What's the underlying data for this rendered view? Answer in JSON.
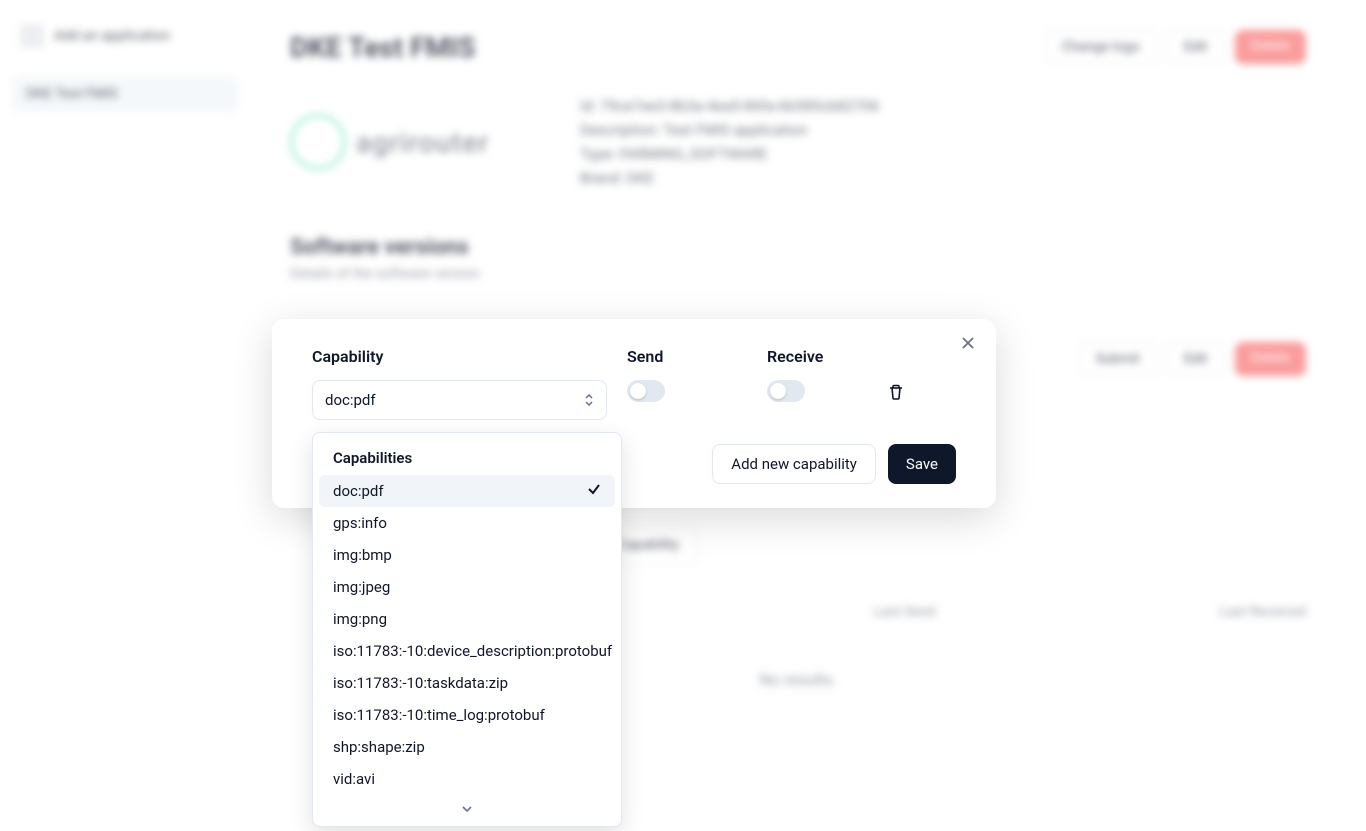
{
  "sidebar": {
    "nav_label": "Add an application",
    "active_item": "DKE Test FMIS"
  },
  "page": {
    "title": "DKE Test FMIS",
    "actions": {
      "change_logo": "Change logo",
      "edit": "Edit",
      "delete": "Delete"
    },
    "logo_text": "agrirouter",
    "meta": {
      "id_line": "Id: 79ce7ee3-8b3a-4ea5-86fa-6b585cb82706",
      "desc_line": "Description: Test FMIS application",
      "type_line": "Type: FARMING_SOFTWARE",
      "brand_line": "Brand: DKE"
    },
    "sv_title": "Software versions",
    "sv_sub": "Details of the software version",
    "version_actions": {
      "submit": "Submit",
      "edit": "Edit",
      "delete": "Delete"
    },
    "add_capability": "Add Capability",
    "cols": {
      "last_send": "Last Send",
      "last_received": "Last Received"
    },
    "no_results": "No results."
  },
  "modal": {
    "labels": {
      "capability": "Capability",
      "send": "Send",
      "receive": "Receive"
    },
    "selected": "doc:pdf",
    "add_btn": "Add new capability",
    "save_btn": "Save"
  },
  "dropdown": {
    "header": "Capabilities",
    "items": [
      "doc:pdf",
      "gps:info",
      "img:bmp",
      "img:jpeg",
      "img:png",
      "iso:11783:-10:device_description:protobuf",
      "iso:11783:-10:taskdata:zip",
      "iso:11783:-10:time_log:protobuf",
      "shp:shape:zip",
      "vid:avi"
    ],
    "selected_index": 0
  }
}
